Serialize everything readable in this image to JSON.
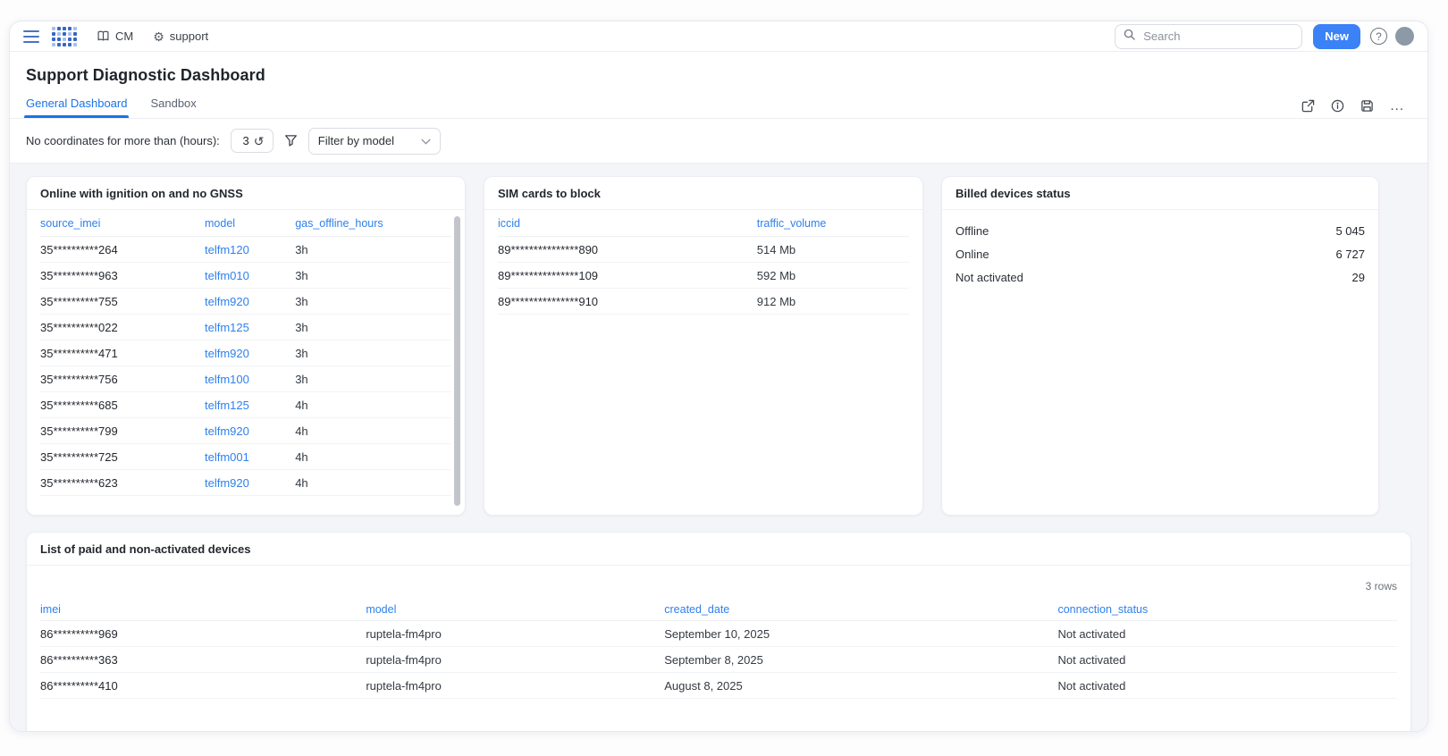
{
  "colors": {
    "accent": "#3b82f6",
    "link": "#2f80ed",
    "tab-active": "#1a73e8"
  },
  "topbar": {
    "cm_label": "CM",
    "support_label": "support",
    "search_placeholder": "Search",
    "new_button": "New",
    "help_glyph": "?"
  },
  "header": {
    "title": "Support Diagnostic Dashboard",
    "tabs": [
      {
        "label": "General Dashboard",
        "active": true
      },
      {
        "label": "Sandbox",
        "active": false
      }
    ],
    "more_glyph": "..."
  },
  "filters": {
    "label": "No coordinates for more than (hours):",
    "hours_value": "3",
    "refresh_glyph": "↺",
    "model_filter_placeholder": "Filter by model"
  },
  "cards": {
    "gnss": {
      "title": "Online with ignition on and no GNSS",
      "columns": [
        "source_imei",
        "model",
        "gas_offline_hours"
      ],
      "rows": [
        [
          "35**********264",
          "telfm120",
          "3h"
        ],
        [
          "35**********963",
          "telfm010",
          "3h"
        ],
        [
          "35**********755",
          "telfm920",
          "3h"
        ],
        [
          "35**********022",
          "telfm125",
          "3h"
        ],
        [
          "35**********471",
          "telfm920",
          "3h"
        ],
        [
          "35**********756",
          "telfm100",
          "3h"
        ],
        [
          "35**********685",
          "telfm125",
          "4h"
        ],
        [
          "35**********799",
          "telfm920",
          "4h"
        ],
        [
          "35**********725",
          "telfm001",
          "4h"
        ],
        [
          "35**********623",
          "telfm920",
          "4h"
        ]
      ]
    },
    "sim": {
      "title": "SIM cards to block",
      "columns": [
        "iccid",
        "traffic_volume"
      ],
      "rows": [
        [
          "89***************890",
          "514 Mb"
        ],
        [
          "89***************109",
          "592 Mb"
        ],
        [
          "89***************910",
          "912 Mb"
        ]
      ]
    },
    "billed": {
      "title": "Billed devices status",
      "rows": [
        {
          "label": "Offline",
          "value": "5 045"
        },
        {
          "label": "Online",
          "value": "6 727"
        },
        {
          "label": "Not activated",
          "value": "29"
        }
      ]
    },
    "paid": {
      "title": "List of paid and non-activated devices",
      "rows_count": "3 rows",
      "columns": [
        "imei",
        "model",
        "created_date",
        "connection_status"
      ],
      "rows": [
        [
          "86**********969",
          "ruptela-fm4pro",
          "September 10, 2025",
          "Not activated"
        ],
        [
          "86**********363",
          "ruptela-fm4pro",
          "September 8, 2025",
          "Not activated"
        ],
        [
          "86**********410",
          "ruptela-fm4pro",
          "August 8, 2025",
          "Not activated"
        ]
      ]
    }
  }
}
